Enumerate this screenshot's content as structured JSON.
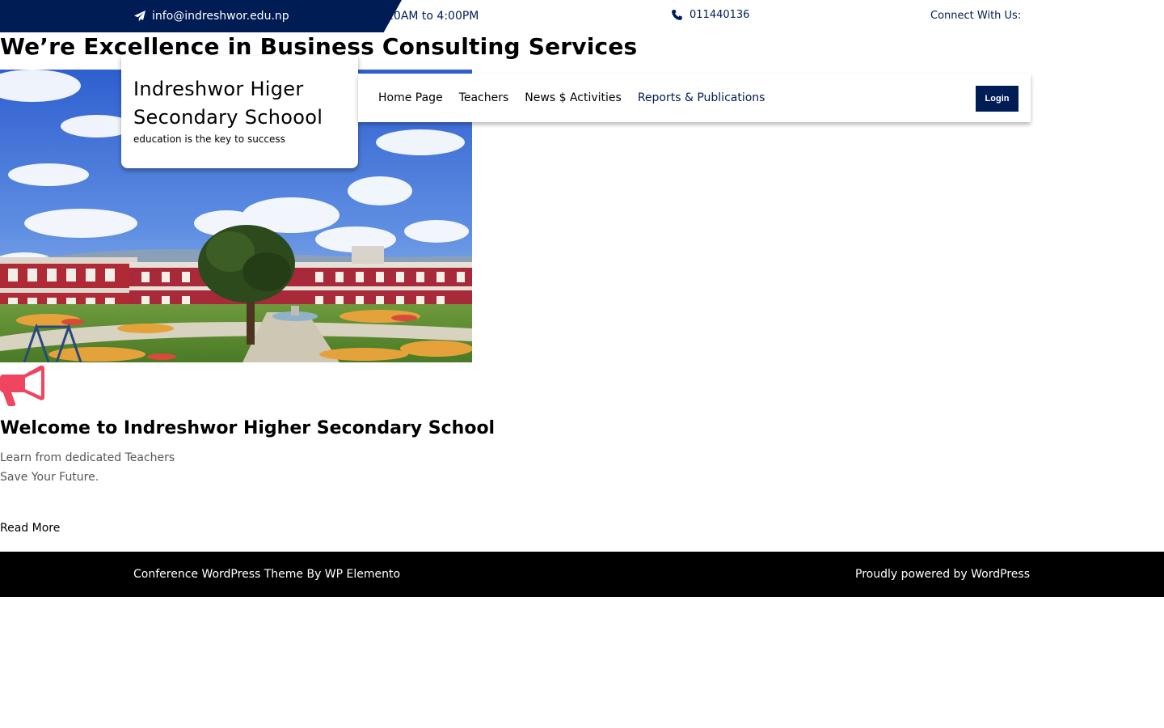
{
  "topbar": {
    "email": "info@indreshwor.edu.np",
    "email_icon": "paper-plane-icon",
    "hours": "10AM to 4:00PM",
    "phone": "011440136",
    "phone_icon": "phone-icon",
    "connect": "Connect With Us:"
  },
  "hero": {
    "title": "We’re Excellence in Business Consulting Services"
  },
  "branding": {
    "site_name": "Indreshwor Higer Secondary Schoool",
    "tagline": "education is the key to success"
  },
  "nav": {
    "items": [
      {
        "label": "Home Page"
      },
      {
        "label": "Teachers"
      },
      {
        "label": "News $ Activities"
      },
      {
        "label": "Reports & Publications"
      }
    ],
    "login": "Login"
  },
  "announcement": {
    "icon": "megaphone-icon",
    "title": "Welcome to Indreshwor Higher Secondary School",
    "lines": [
      "Learn from dedicated Teachers",
      "Save Your Future."
    ],
    "read_more": "Read More"
  },
  "footer": {
    "left": "Conference WordPress Theme By WP Elemento",
    "right": "Proudly powered by WordPress"
  },
  "colors": {
    "navy": "#001c54",
    "accent_red": "#ef4560",
    "footer_bg": "#000000"
  }
}
